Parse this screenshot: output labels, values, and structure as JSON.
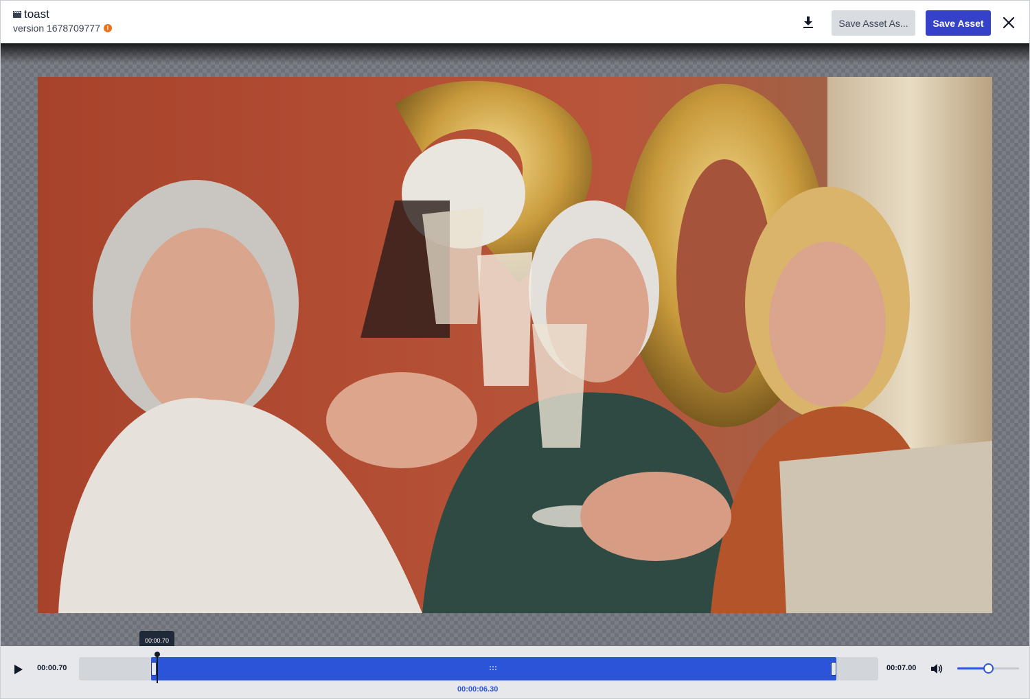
{
  "header": {
    "asset_title": "toast",
    "version_label": "version 1678709777",
    "warning_glyph": "!",
    "download_icon": "download-icon",
    "save_as_label": "Save Asset As...",
    "save_label": "Save Asset",
    "close_icon": "close-icon"
  },
  "player": {
    "tooltip_time": "00:00.70",
    "current_time": "00:00.70",
    "end_time": "00:07.00",
    "selection_duration": "00:00:06.30",
    "volume_level": 0.5,
    "accent_color": "#2b54d9"
  },
  "colors": {
    "primary_button": "#3541c9",
    "secondary_button": "#d9dce1",
    "warning": "#e8731c"
  }
}
